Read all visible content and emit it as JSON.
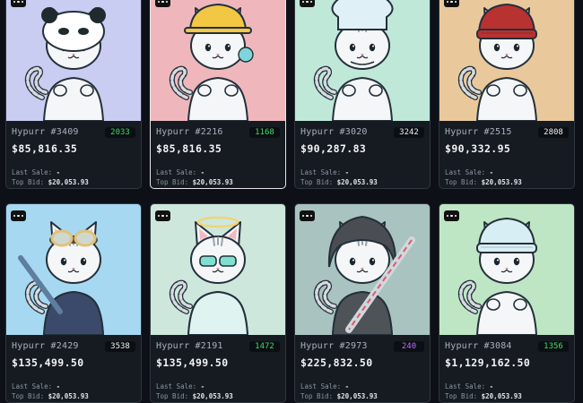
{
  "cards": [
    {
      "name": "Hypurr #3409",
      "rank": "2033",
      "rank_color": "green",
      "price": "$85,816.35",
      "last_sale_label": "Last Sale:",
      "last_sale_value": "-",
      "top_bid_label": "Top Bid:",
      "top_bid_value": "$20,053.93",
      "bg": "#c9cdf2",
      "hat": "panda",
      "hat_color": "#ffffff",
      "selected": false
    },
    {
      "name": "Hypurr #2216",
      "rank": "1168",
      "rank_color": "green",
      "price": "$85,816.35",
      "last_sale_label": "Last Sale:",
      "last_sale_value": "-",
      "top_bid_label": "Top Bid:",
      "top_bid_value": "$20,053.93",
      "bg": "#efb7bc",
      "hat": "hardhat",
      "hat_color": "#f2c744",
      "selected": true
    },
    {
      "name": "Hypurr #3020",
      "rank": "3242",
      "rank_color": "white",
      "price": "$90,287.83",
      "last_sale_label": "Last Sale:",
      "last_sale_value": "-",
      "top_bid_label": "Top Bid:",
      "top_bid_value": "$20,053.93",
      "bg": "#bfe8d9",
      "hat": "chef",
      "hat_color": "#dff0f7",
      "selected": false
    },
    {
      "name": "Hypurr #2515",
      "rank": "2808",
      "rank_color": "white",
      "price": "$90,332.95",
      "last_sale_label": "Last Sale:",
      "last_sale_value": "-",
      "top_bid_label": "Top Bid:",
      "top_bid_value": "$20,053.93",
      "bg": "#e9c99b",
      "hat": "beanie",
      "hat_color": "#b83232",
      "selected": false
    },
    {
      "name": "Hypurr #2429",
      "rank": "3538",
      "rank_color": "white",
      "price": "$135,499.50",
      "last_sale_label": "Last Sale:",
      "last_sale_value": "-",
      "top_bid_label": "Top Bid:",
      "top_bid_value": "$20,053.93",
      "bg": "#a6d8f2",
      "hat": "goggles",
      "hat_color": "#e0c27a",
      "selected": false
    },
    {
      "name": "Hypurr #2191",
      "rank": "1472",
      "rank_color": "green",
      "price": "$135,499.50",
      "last_sale_label": "Last Sale:",
      "last_sale_value": "-",
      "top_bid_label": "Top Bid:",
      "top_bid_value": "$20,053.93",
      "bg": "#cde7dc",
      "hat": "halo",
      "hat_color": "#f0d477",
      "selected": false
    },
    {
      "name": "Hypurr #2973",
      "rank": "240",
      "rank_color": "purple",
      "price": "$225,832.50",
      "last_sale_label": "Last Sale:",
      "last_sale_value": "-",
      "top_bid_label": "Top Bid:",
      "top_bid_value": "$20,053.93",
      "bg": "#a9c3c0",
      "hat": "hood",
      "hat_color": "#4a4e52",
      "selected": false
    },
    {
      "name": "Hypurr #3084",
      "rank": "1356",
      "rank_color": "green",
      "price": "$1,129,162.50",
      "last_sale_label": "Last Sale:",
      "last_sale_value": "-",
      "top_bid_label": "Top Bid:",
      "top_bid_value": "$20,053.93",
      "bg": "#bfe6c4",
      "hat": "beanie",
      "hat_color": "#d8eef5",
      "selected": false
    }
  ]
}
